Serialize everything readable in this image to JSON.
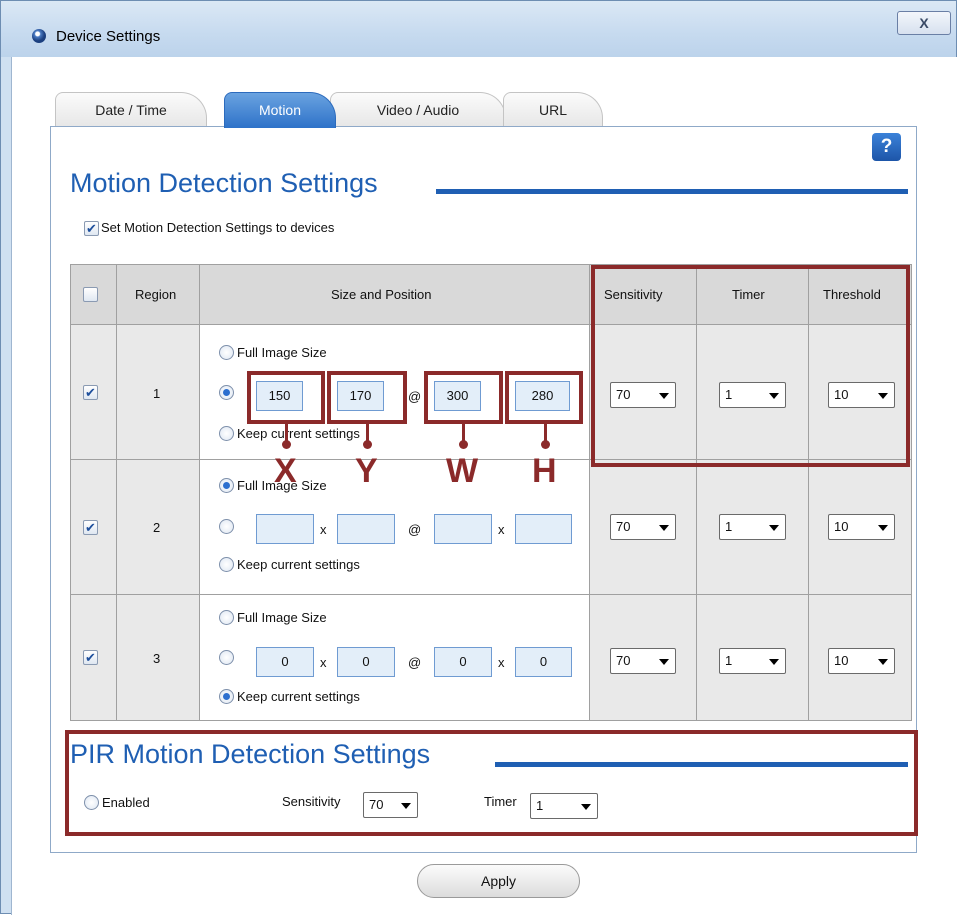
{
  "window": {
    "title": "Device Settings",
    "close_label": "X"
  },
  "tabs": [
    {
      "label": "Date / Time"
    },
    {
      "label": "Motion"
    },
    {
      "label": "Video / Audio"
    },
    {
      "label": "URL"
    }
  ],
  "help": {
    "label": "?"
  },
  "motion": {
    "title": "Motion Detection Settings",
    "apply_to_devices_label": "Set Motion Detection Settings to devices",
    "headers": {
      "region": "Region",
      "size_position": "Size and Position",
      "sensitivity": "Sensitivity",
      "timer": "Timer",
      "threshold": "Threshold"
    },
    "full_image_label": "Full Image Size",
    "keep_label": "Keep current settings",
    "x_sep": "x",
    "at_sep": "@",
    "rows": [
      {
        "region": "1",
        "x": "150",
        "y": "170",
        "w": "300",
        "h": "280",
        "sensitivity": "70",
        "timer": "1",
        "threshold": "10"
      },
      {
        "region": "2",
        "x": "",
        "y": "",
        "w": "",
        "h": "",
        "sensitivity": "70",
        "timer": "1",
        "threshold": "10"
      },
      {
        "region": "3",
        "x": "0",
        "y": "0",
        "w": "0",
        "h": "0",
        "sensitivity": "70",
        "timer": "1",
        "threshold": "10"
      }
    ]
  },
  "annotations": {
    "x": "X",
    "y": "Y",
    "w": "W",
    "h": "H"
  },
  "pir": {
    "title": "PIR Motion Detection Settings",
    "enabled_label": "Enabled",
    "sensitivity_label": "Sensitivity",
    "sensitivity_value": "70",
    "timer_label": "Timer",
    "timer_value": "1"
  },
  "apply_label": "Apply",
  "colors": {
    "accent": "#1f5fb3",
    "annotation": "#8b2a2a"
  }
}
